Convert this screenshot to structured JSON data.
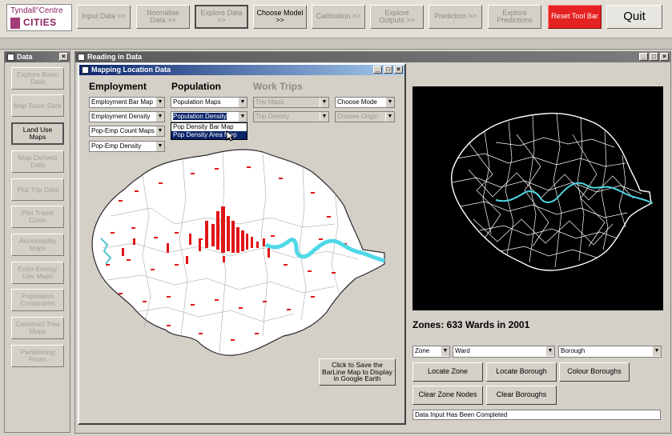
{
  "toolbar": {
    "logo_line1": "Tyndall°Centre",
    "logo_line2": "CITIES",
    "buttons": [
      {
        "label": "Input Data >>"
      },
      {
        "label": "Normalise Data >>"
      },
      {
        "label": "Explore Data >>"
      },
      {
        "label": "Choose Model >>"
      },
      {
        "label": "Calibration >>"
      },
      {
        "label": "Explore Outputs >>"
      },
      {
        "label": "Prediction >>"
      },
      {
        "label": "Explore Predictions"
      },
      {
        "label": "Reset Tool Bar"
      }
    ],
    "quit_label": "Quit",
    "reset_color": "#e52222"
  },
  "data_panel": {
    "title": "Data",
    "close": "×",
    "buttons": [
      "Explore Basic Data",
      "Map Basic Data",
      "Land Use Maps",
      "Map Derived Data",
      "Plot Trip Data",
      "Plot Travel Costs",
      "Accessibility Maps",
      "Econ-Energy Use Maps",
      "Population Constraints",
      "Construct Tree Maps",
      "Partitioning Flows"
    ]
  },
  "reading_window": {
    "title": "Reading in Data",
    "controls": [
      "_",
      "□",
      "×"
    ]
  },
  "mapping_dialog": {
    "title": "Mapping Location Data",
    "controls": [
      "_",
      "□",
      "×"
    ],
    "headers": {
      "employment": "Employment",
      "population": "Population",
      "work_trips": "Work Trips"
    },
    "employment_combos": [
      "Employment Bar Map",
      "Employment Density",
      "Pop-Emp Count Maps",
      "Pop-Emp Density"
    ],
    "population_combos": [
      "Population Maps",
      "Population Density"
    ],
    "population_dropdown": [
      "Pop Density Bar Map",
      "Pop Density Area Map"
    ],
    "work_trip_combos": [
      "Trip Maps",
      "Trip Density"
    ],
    "choose_combos": [
      "Choose Mode",
      "Choose Origin"
    ],
    "save_button": "Click to Save the BarLine Map to Display in Google Earth"
  },
  "right_panel": {
    "zones_label": "Zones: 633 Wards in 2001",
    "combos": [
      "Zone",
      "Ward",
      "Borough"
    ],
    "buttons": [
      "Locate Zone",
      "Locate Borough",
      "Colour Boroughs",
      "Clear Zone Nodes",
      "Clear Boroughs"
    ],
    "status": "Data Input Has Been Completed",
    "river_color": "#4fd4e0"
  }
}
